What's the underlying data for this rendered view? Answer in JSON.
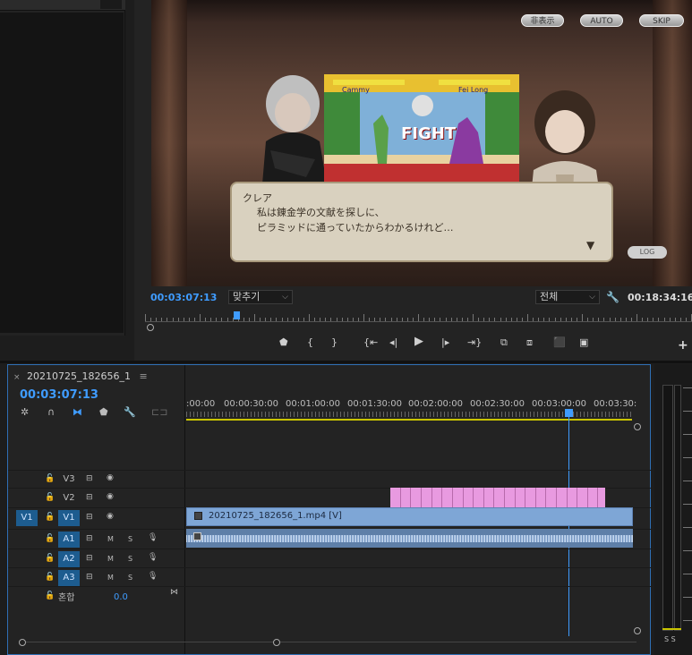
{
  "monitor": {
    "video_ui": {
      "hide_label": "非表示",
      "auto_label": "AUTO",
      "skip_label": "SKIP",
      "log_label": "LOG"
    },
    "dialog": {
      "speaker": "クレア",
      "line1": "私は錬金学の文献を探しに、",
      "line2": "ピラミッドに通っていたからわかるけれど…"
    },
    "game": {
      "title": "FIGHT",
      "p1": "Cammy",
      "p2": "Fei Long"
    },
    "timecode_current": "00:03:07:13",
    "fit_select": "맞추기",
    "quality_select": "전체",
    "timecode_duration": "00:18:34:16",
    "transport": [
      "marker-in",
      "mark-in",
      "mark-out",
      "go-to-in",
      "step-back",
      "play",
      "step-forward",
      "go-to-out",
      "insert",
      "overwrite",
      "export-frame",
      "comparison-view"
    ]
  },
  "timeline": {
    "tab_title": "20210725_182656_1",
    "timecode": "00:03:07:13",
    "ruler_times": [
      ":00:00",
      "00:00:30:00",
      "00:01:00:00",
      "00:01:30:00",
      "00:02:00:00",
      "00:02:30:00",
      "00:03:00:00",
      "00:03:30:"
    ],
    "tracks": {
      "v3": "V3",
      "v2": "V2",
      "v1": "V1",
      "src_v1": "V1",
      "a1": "A1",
      "a2": "A2",
      "a3": "A3"
    },
    "mix_label": "혼합",
    "mix_value": "0.0",
    "clip_v1_label": "20210725_182656_1.mp4 [V]",
    "ms_m": "M",
    "ms_s": "S"
  },
  "meter": {
    "solo": "S S"
  },
  "colors": {
    "accent": "#3f9cff",
    "v2_clip": "#e89ae0",
    "v1_clip": "#7ea6d6",
    "a1_clip": "#5e7fa8",
    "work_area": "#c9c400"
  }
}
